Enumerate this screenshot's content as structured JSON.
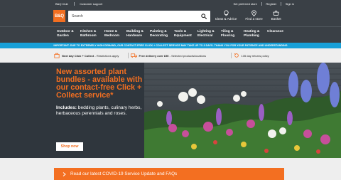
{
  "brand": {
    "logo_text": "B&Q",
    "accent": "#f36f21",
    "banner_blue": "#18a0d8"
  },
  "top_links_left": [
    "B&Q Club",
    "Customer support"
  ],
  "top_links_right": [
    "Set preferred store",
    "Register",
    "Sign in"
  ],
  "search": {
    "placeholder": "Search",
    "icon": "search-icon"
  },
  "header_tools": [
    {
      "label": "Ideas & Advice",
      "icon": "lightbulb-icon"
    },
    {
      "label": "Find a store",
      "icon": "map-pin-icon"
    },
    {
      "label": "Basket",
      "icon": "basket-icon"
    }
  ],
  "nav": [
    {
      "line1": "Outdoor &",
      "line2": "Garden"
    },
    {
      "line1": "Kitchen &",
      "line2": "Bathroom"
    },
    {
      "line1": "Home &",
      "line2": "Bedroom"
    },
    {
      "line1": "Building &",
      "line2": "Hardware"
    },
    {
      "line1": "Painting &",
      "line2": "Decorating"
    },
    {
      "line1": "Tools &",
      "line2": "Equipment"
    },
    {
      "line1": "Lighting &",
      "line2": "Electrical"
    },
    {
      "line1": "Tiling &",
      "line2": "Flooring"
    },
    {
      "line1": "Heating &",
      "line2": "Plumbing"
    },
    {
      "line1": "Clearance",
      "line2": ""
    }
  ],
  "blue_banner": "IMPORTANT: DUE TO EXTREMELY HIGH DEMAND, OUR CONTACT-FREE CLICK + COLLECT SERVICE MAY TAKE UP TO 3 DAYS. THANK YOU FOR YOUR PATIENCE AND UNDERSTANDING",
  "benefits": [
    {
      "bold": "Next day Click + Collect",
      "rest": "- Restrictions apply",
      "icon": "click-collect-icon"
    },
    {
      "bold": "Free delivery over £50",
      "rest": "- Selected products/locations",
      "icon": "delivery-truck-icon"
    },
    {
      "bold": "",
      "rest": "135 day returns policy",
      "icon": "returns-icon"
    }
  ],
  "hero": {
    "title": "New assorted plant bundles - available with our contact-free Click + Collect service*",
    "includes_label": "Includes:",
    "includes_text": " bedding plants, culinary herbs, herbaceous perennials and roses.",
    "cta": "Shop now"
  },
  "covid_link": "Read our latest COVID-19 Service Update and FAQs"
}
